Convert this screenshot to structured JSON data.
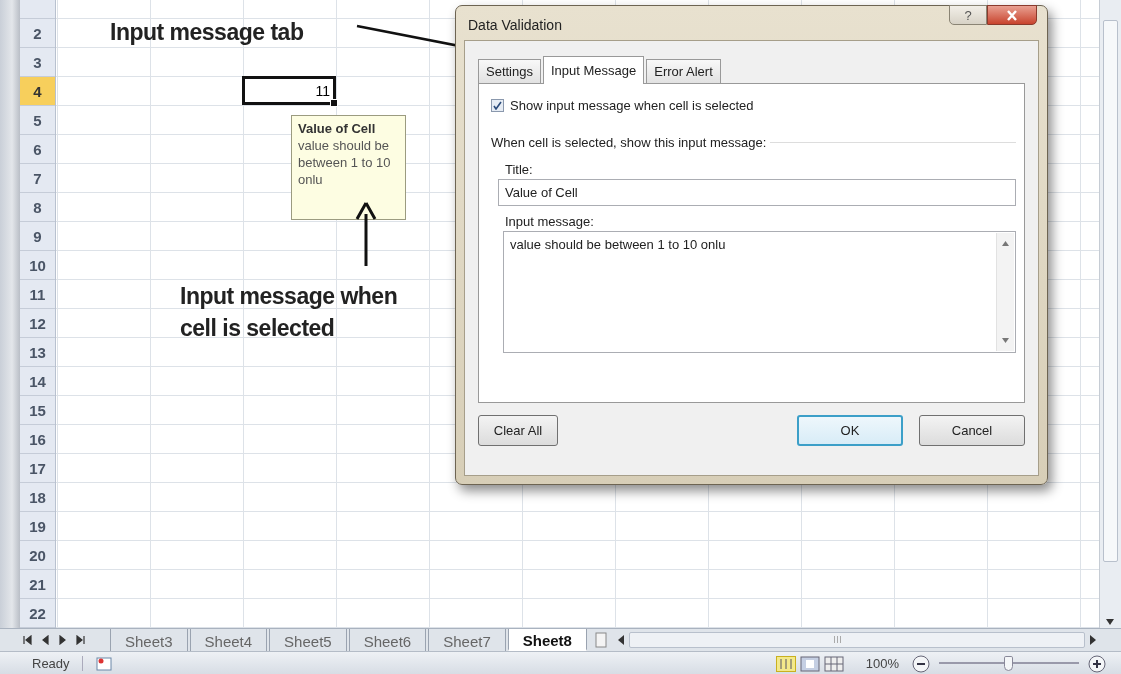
{
  "annotations": [
    {
      "text": "Input message tab"
    },
    {
      "text": "Input message when cell is selected"
    }
  ],
  "sheet": {
    "rows": [
      {
        "label": "2",
        "selected": false
      },
      {
        "label": "3",
        "selected": false
      },
      {
        "label": "4",
        "selected": true
      },
      {
        "label": "5",
        "selected": false
      },
      {
        "label": "6",
        "selected": false
      },
      {
        "label": "7",
        "selected": false
      },
      {
        "label": "8",
        "selected": false
      },
      {
        "label": "9",
        "selected": false
      },
      {
        "label": "10",
        "selected": false
      },
      {
        "label": "11",
        "selected": false
      },
      {
        "label": "12",
        "selected": false
      },
      {
        "label": "13",
        "selected": false
      },
      {
        "label": "14",
        "selected": false
      },
      {
        "label": "15",
        "selected": false
      },
      {
        "label": "16",
        "selected": false
      },
      {
        "label": "17",
        "selected": false
      },
      {
        "label": "18",
        "selected": false
      },
      {
        "label": "19",
        "selected": false
      },
      {
        "label": "20",
        "selected": false
      },
      {
        "label": "21",
        "selected": false
      },
      {
        "label": "22",
        "selected": false
      }
    ],
    "active_cell": {
      "value": "11"
    },
    "input_tooltip": {
      "title": "Value of Cell",
      "message": "value should be between 1 to 10 onlu"
    }
  },
  "dialog": {
    "title": "Data Validation",
    "help": "?",
    "tabs": [
      {
        "label": "Settings",
        "selected": false
      },
      {
        "label": "Input Message",
        "selected": true
      },
      {
        "label": "Error Alert",
        "selected": false
      }
    ],
    "show_message": {
      "label": "Show input message when cell is selected",
      "checked": true
    },
    "section_label": "When cell is selected, show this input message:",
    "title_field": {
      "label": "Title:",
      "value": "Value of Cell"
    },
    "message_field": {
      "label": "Input message:",
      "value": "value should be between 1 to 10 onlu"
    },
    "buttons": [
      {
        "label": "Clear All",
        "kind": "secondary"
      },
      {
        "label": "OK",
        "kind": "default"
      },
      {
        "label": "Cancel",
        "kind": "secondary"
      }
    ]
  },
  "sheet_tabs": [
    {
      "label": "Sheet3",
      "selected": false
    },
    {
      "label": "Sheet4",
      "selected": false
    },
    {
      "label": "Sheet5",
      "selected": false
    },
    {
      "label": "Sheet6",
      "selected": false
    },
    {
      "label": "Sheet7",
      "selected": false
    },
    {
      "label": "Sheet8",
      "selected": true
    }
  ],
  "status_bar": {
    "status": "Ready",
    "zoom": "100%",
    "zoom_slider": {
      "level": 0.5
    }
  }
}
